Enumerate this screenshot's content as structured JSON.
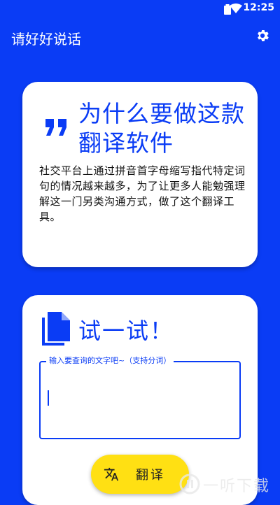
{
  "status_bar": {
    "time": "12:25"
  },
  "app_bar": {
    "title": "请好好说话"
  },
  "intro_card": {
    "headline": "为什么要做这款翻译软件",
    "description": "社交平台上通过拼音首字母缩写指代特定词句的情况越来越多，为了让更多人能勉强理解这一门另类沟通方式，做了这个翻译工具。"
  },
  "try_card": {
    "title": "试一试！",
    "input_label": "输入要查询的文字吧~（支持分词）",
    "input_value": ""
  },
  "translate_button": {
    "label": "翻译"
  },
  "watermark": {
    "text": "一听下载"
  },
  "colors": {
    "primary": "#0a3cf5",
    "accent": "#ffe013",
    "card": "#ffffff"
  },
  "icons": [
    "wifi-icon",
    "battery-icon",
    "gear-icon",
    "quote-icon",
    "document-icon",
    "translate-icon"
  ]
}
